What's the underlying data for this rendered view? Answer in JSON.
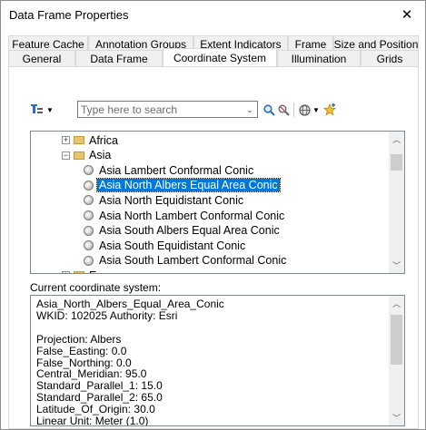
{
  "window": {
    "title": "Data Frame Properties",
    "close_glyph": "✕"
  },
  "tabs_back": [
    "Feature Cache",
    "Annotation Groups",
    "Extent Indicators",
    "Frame",
    "Size and Position"
  ],
  "tabs_front": [
    "General",
    "Data Frame",
    "Coordinate System",
    "Illumination",
    "Grids"
  ],
  "active_tab": "Coordinate System",
  "toolbar": {
    "search_placeholder": "Type here to search",
    "search_value": ""
  },
  "tree": {
    "rows": [
      {
        "kind": "folder",
        "expander": "+",
        "label": "Africa"
      },
      {
        "kind": "folder",
        "expander": "−",
        "label": "Asia"
      },
      {
        "kind": "item",
        "label": "Asia Lambert Conformal Conic"
      },
      {
        "kind": "item",
        "label": "Asia North Albers Equal Area Conic",
        "selected": true
      },
      {
        "kind": "item",
        "label": "Asia North Equidistant Conic"
      },
      {
        "kind": "item",
        "label": "Asia North Lambert Conformal Conic"
      },
      {
        "kind": "item",
        "label": "Asia South Albers Equal Area Conic"
      },
      {
        "kind": "item",
        "label": "Asia South Equidistant Conic"
      },
      {
        "kind": "item",
        "label": "Asia South Lambert Conformal Conic"
      },
      {
        "kind": "folder",
        "expander": "+",
        "label": "Europe"
      }
    ]
  },
  "current": {
    "label": "Current coordinate system:",
    "lines": [
      "Asia_North_Albers_Equal_Area_Conic",
      "WKID: 102025 Authority: Esri",
      "",
      "Projection: Albers",
      "False_Easting: 0.0",
      "False_Northing: 0.0",
      "Central_Meridian: 95.0",
      "Standard_Parallel_1: 15.0",
      "Standard_Parallel_2: 65.0",
      "Latitude_Of_Origin: 30.0",
      "Linear Unit: Meter (1.0)"
    ]
  },
  "colors": {
    "selection": "#0078d7",
    "folder": "#e8c46a",
    "border": "#828790"
  }
}
